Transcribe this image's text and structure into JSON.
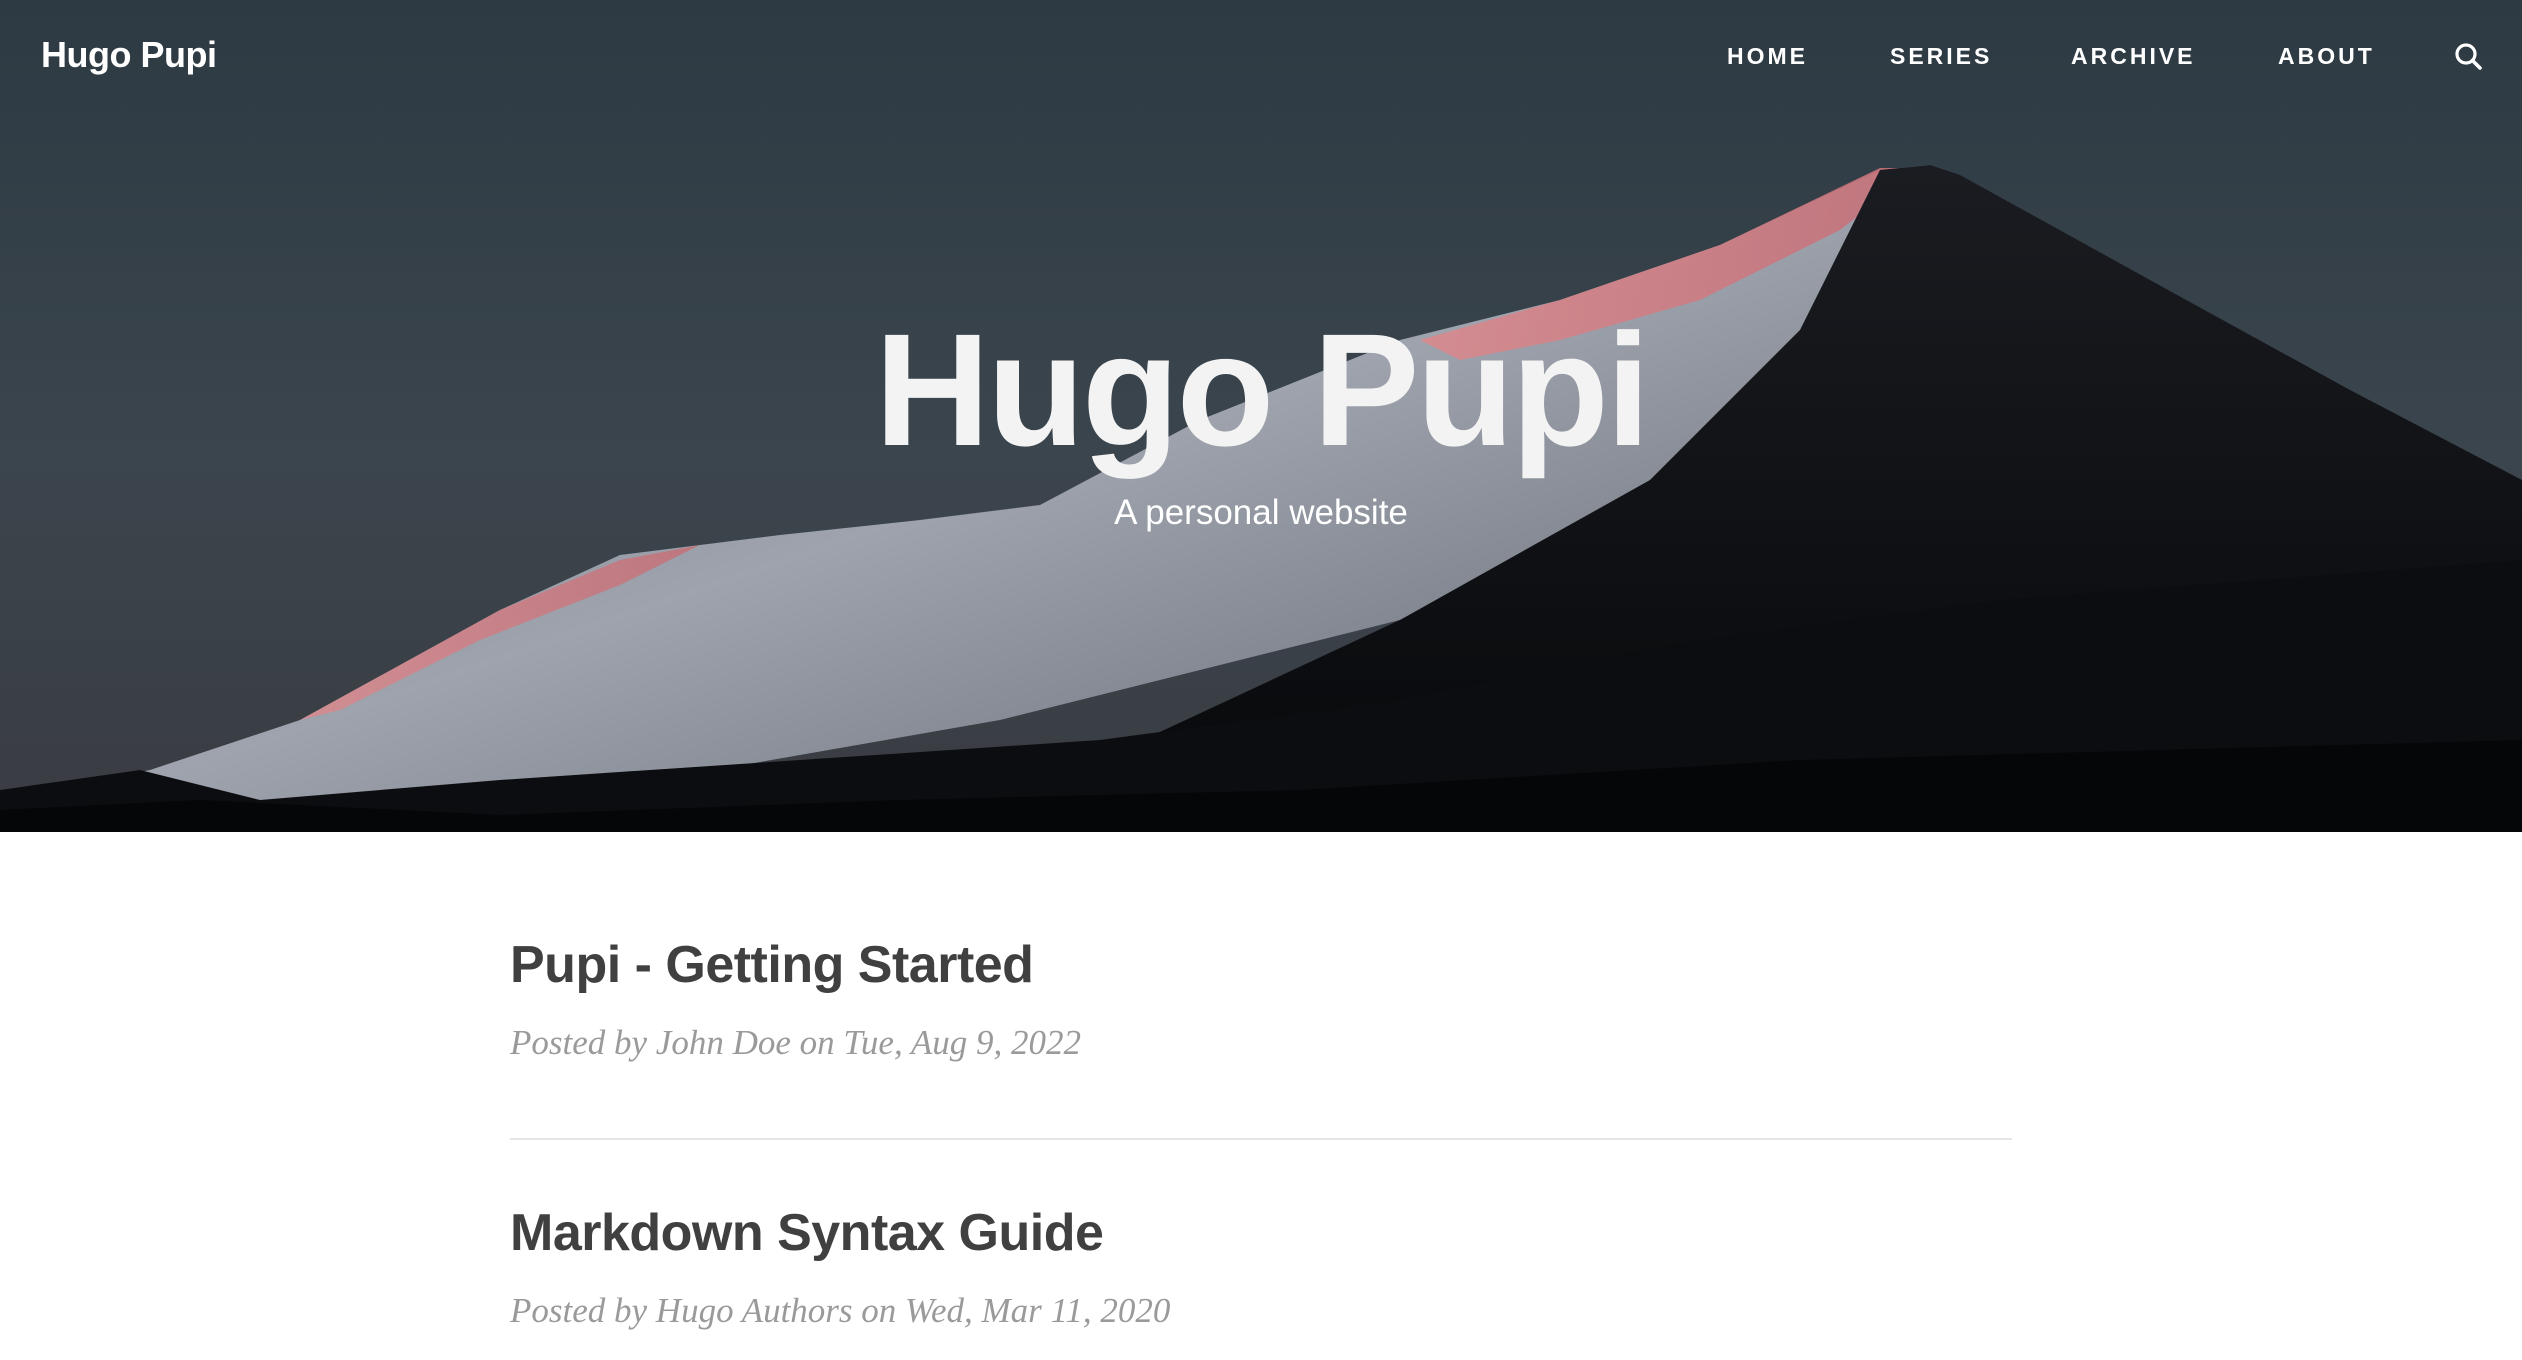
{
  "navbar": {
    "brand": "Hugo Pupi",
    "links": [
      {
        "label": "HOME"
      },
      {
        "label": "SERIES"
      },
      {
        "label": "ARCHIVE"
      },
      {
        "label": "ABOUT"
      }
    ],
    "search_icon": "search-icon"
  },
  "hero": {
    "title": "Hugo Pupi",
    "subtitle": "A personal website"
  },
  "posts": [
    {
      "title": "Pupi - Getting Started",
      "meta": "Posted by John Doe on Tue, Aug 9, 2022"
    },
    {
      "title": "Markdown Syntax Guide",
      "meta": "Posted by Hugo Authors on Wed, Mar 11, 2020"
    }
  ],
  "colors": {
    "text_dark": "#404040",
    "meta_gray": "#9a9a9a",
    "divider": "#e6e6e6",
    "hero_text": "#ffffff"
  }
}
